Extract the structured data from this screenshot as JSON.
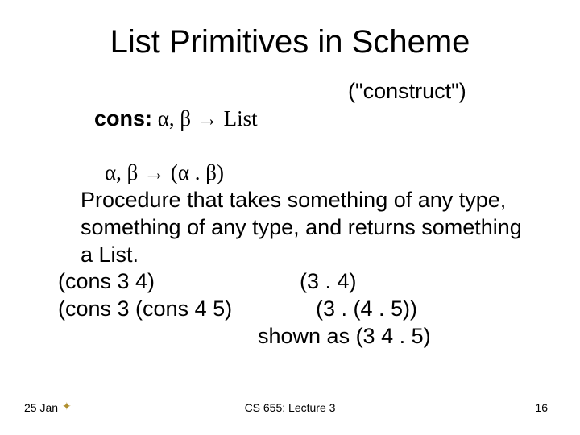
{
  "title": "List Primitives in Scheme",
  "line1_label": "cons:",
  "line1_sig": " α, β → List",
  "line1_gloss": "(\"construct\")",
  "line2": "α, β → (α . β)",
  "desc": "Procedure that takes something of any type, something of any type, and returns something a List.",
  "ex1_call": "(cons 3 4)",
  "ex1_result": "(3 . 4)",
  "ex2_call": "(cons 3 (cons 4 5)",
  "ex2_result": "(3 . (4 . 5))",
  "shown_as": "shown as (3 4 . 5)",
  "footer_date": "25 Jan",
  "footer_course": "CS 655: Lecture 3",
  "footer_page": "16"
}
